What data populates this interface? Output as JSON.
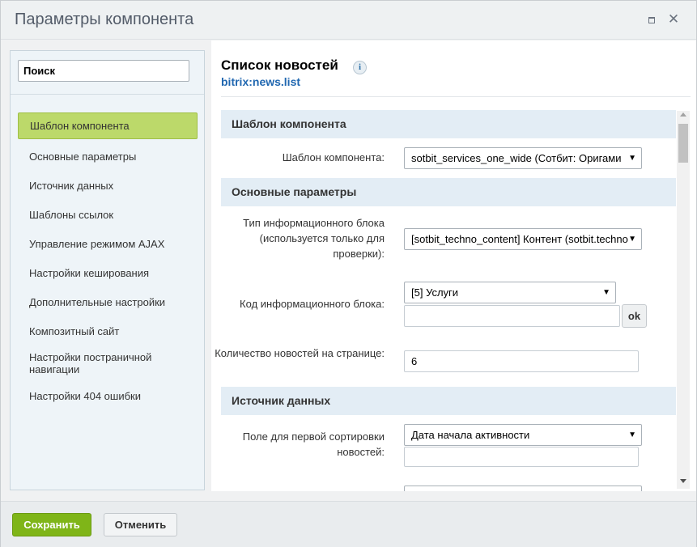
{
  "window": {
    "title": "Параметры компонента"
  },
  "sidebar": {
    "search_placeholder": "Поиск",
    "items": [
      {
        "label": "Шаблон компонента"
      },
      {
        "label": "Основные параметры"
      },
      {
        "label": "Источник данных"
      },
      {
        "label": "Шаблоны ссылок"
      },
      {
        "label": "Управление режимом AJAX"
      },
      {
        "label": "Настройки кеширования"
      },
      {
        "label": "Дополнительные настройки"
      },
      {
        "label": "Композитный сайт"
      },
      {
        "label": "Настройки постраничной навигации"
      },
      {
        "label": "Настройки 404 ошибки"
      }
    ]
  },
  "component": {
    "title": "Список новостей",
    "code": "bitrix:news.list",
    "info_icon": "i"
  },
  "sections": {
    "template": {
      "title": "Шаблон компонента",
      "template_label": "Шаблон компонента:",
      "template_value": "sotbit_services_one_wide (Сотбит: Оригами"
    },
    "main": {
      "title": "Основные параметры",
      "iblock_type_label": "Тип информационного блока (используется только для проверки):",
      "iblock_type_value": "[sotbit_techno_content] Контент (sotbit.techno",
      "iblock_code_label": "Код информационного блока:",
      "iblock_code_value": "[5] Услуги",
      "iblock_code_input": "",
      "ok_label": "ok",
      "news_count_label": "Количество новостей на странице:",
      "news_count_value": "6"
    },
    "source": {
      "title": "Источник данных",
      "sort1_label": "Поле для первой сортировки новостей:",
      "sort1_value": "Дата начала активности",
      "sort1_input": ""
    }
  },
  "footer": {
    "save_label": "Сохранить",
    "cancel_label": "Отменить"
  },
  "colors": {
    "save_green": "#7fb518",
    "active_item": "#bcd96a",
    "section_bg": "#e3edf5",
    "code_blue": "#2067b0"
  }
}
